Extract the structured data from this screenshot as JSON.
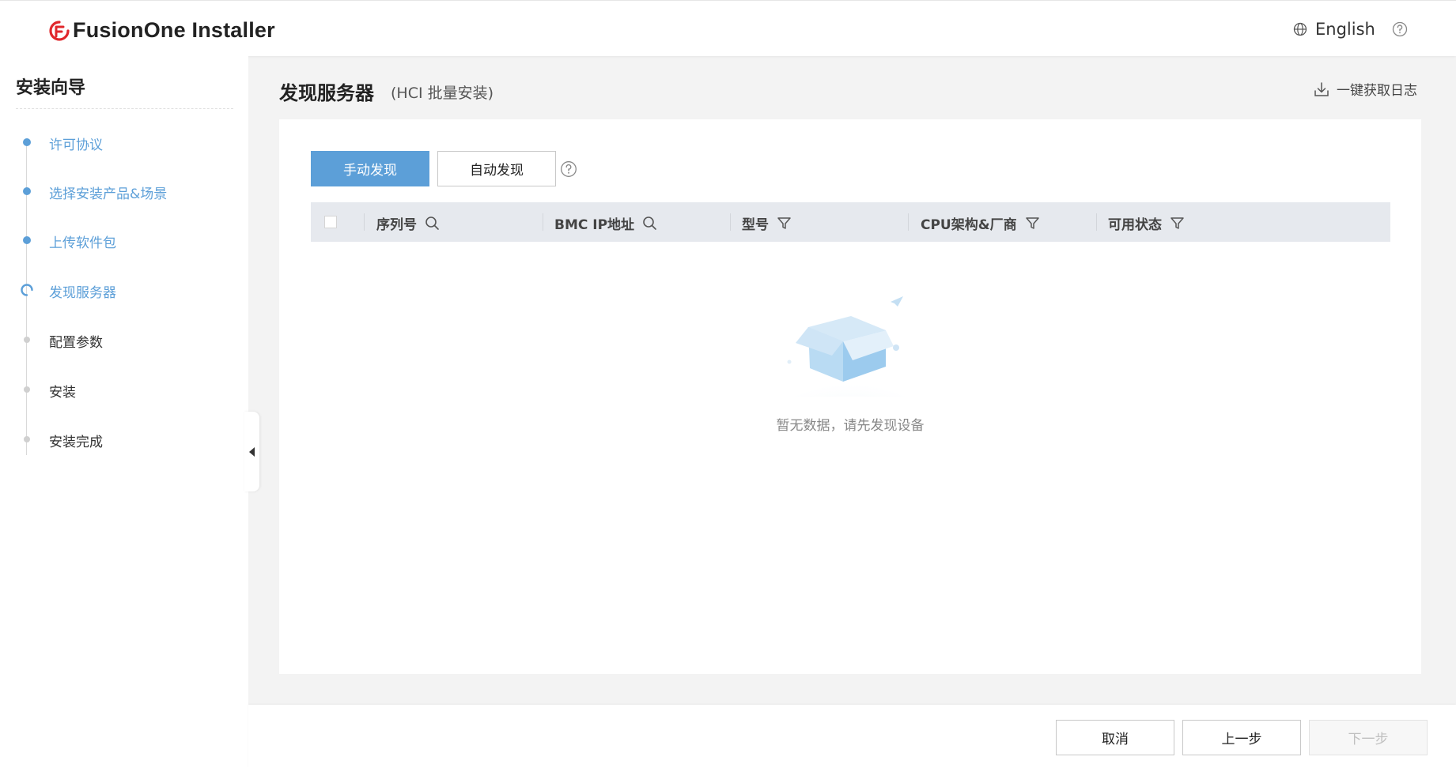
{
  "header": {
    "brand": "FusionOne  Installer",
    "language_label": "English"
  },
  "sidebar": {
    "title": "安装向导",
    "steps": [
      {
        "label": "许可协议",
        "state": "done"
      },
      {
        "label": "选择安装产品&场景",
        "state": "done"
      },
      {
        "label": "上传软件包",
        "state": "done"
      },
      {
        "label": "发现服务器",
        "state": "current"
      },
      {
        "label": "配置参数",
        "state": "todo"
      },
      {
        "label": "安装",
        "state": "todo"
      },
      {
        "label": "安装完成",
        "state": "todo"
      }
    ]
  },
  "main": {
    "title": "发现服务器",
    "subtitle": "(HCI 批量安装)",
    "log_button": "一键获取日志",
    "tabs": {
      "manual": "手动发现",
      "auto": "自动发现"
    },
    "table": {
      "columns": [
        {
          "label": "序列号",
          "tool": "search"
        },
        {
          "label": "BMC IP地址",
          "tool": "search"
        },
        {
          "label": "型号",
          "tool": "filter"
        },
        {
          "label": "CPU架构&厂商",
          "tool": "filter"
        },
        {
          "label": "可用状态",
          "tool": "filter"
        }
      ],
      "empty_text": "暂无数据，请先发现设备"
    }
  },
  "footer": {
    "cancel": "取消",
    "prev": "上一步",
    "next": "下一步"
  },
  "colors": {
    "accent": "#5c9fd8",
    "brand_red": "#e0262b"
  }
}
